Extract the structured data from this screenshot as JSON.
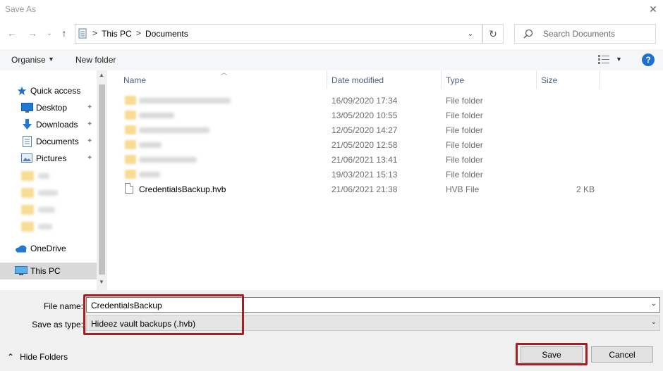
{
  "window": {
    "title": "Save As",
    "close_glyph": "✕"
  },
  "nav": {
    "back_glyph": "←",
    "forward_glyph": "→",
    "recent_glyph": "⌄",
    "up_glyph": "↑",
    "breadcrumb": [
      "This PC",
      "Documents"
    ],
    "refresh_glyph": "↻",
    "search_placeholder": "Search Documents",
    "icons": [
      "this-pc-icon",
      "search-icon"
    ]
  },
  "toolbar": {
    "organise_label": "Organise",
    "new_folder_label": "New folder",
    "view_caret": "▼",
    "help_label": "?"
  },
  "sidebar": {
    "items": [
      {
        "label": "Quick access",
        "icon": "star-icon",
        "pinned": false
      },
      {
        "label": "Desktop",
        "icon": "desktop-icon",
        "pinned": true
      },
      {
        "label": "Downloads",
        "icon": "download-icon",
        "pinned": true
      },
      {
        "label": "Documents",
        "icon": "documents-icon",
        "pinned": true
      },
      {
        "label": "Pictures",
        "icon": "pictures-icon",
        "pinned": true
      },
      {
        "label": "OneDrive",
        "icon": "cloud-icon",
        "pinned": false
      },
      {
        "label": "This PC",
        "icon": "monitor-icon",
        "pinned": false,
        "selected": true
      }
    ],
    "pin_glyph": "📌"
  },
  "filelist": {
    "columns": [
      "Name",
      "Date modified",
      "Type",
      "Size"
    ],
    "rows": [
      {
        "name": "",
        "blurred": true,
        "date": "16/09/2020 17:34",
        "type": "File folder",
        "size": ""
      },
      {
        "name": "",
        "blurred": true,
        "date": "13/05/2020 10:55",
        "type": "File folder",
        "size": ""
      },
      {
        "name": "",
        "blurred": true,
        "date": "12/05/2020 14:27",
        "type": "File folder",
        "size": ""
      },
      {
        "name": "",
        "blurred": true,
        "date": "21/05/2020 12:58",
        "type": "File folder",
        "size": ""
      },
      {
        "name": "",
        "blurred": true,
        "date": "21/06/2021 13:41",
        "type": "File folder",
        "size": ""
      },
      {
        "name": "",
        "blurred": true,
        "date": "19/03/2021 15:13",
        "type": "File folder",
        "size": ""
      },
      {
        "name": "CredentialsBackup.hvb",
        "blurred": false,
        "date": "21/06/2021 21:38",
        "type": "HVB File",
        "size": "2 KB"
      }
    ]
  },
  "form": {
    "file_name_label": "File name:",
    "file_name_value": "CredentialsBackup",
    "save_type_label": "Save as type:",
    "save_type_value": "Hideez vault backups (.hvb)",
    "dropdown_glyph": "⌄"
  },
  "footer": {
    "hide_folders_label": "Hide Folders",
    "hide_folders_glyph": "⌃",
    "save_label": "Save",
    "cancel_label": "Cancel"
  },
  "colors": {
    "highlight": "#a41e22",
    "accent": "#1d6fd0",
    "folder": "#f9dc93"
  }
}
